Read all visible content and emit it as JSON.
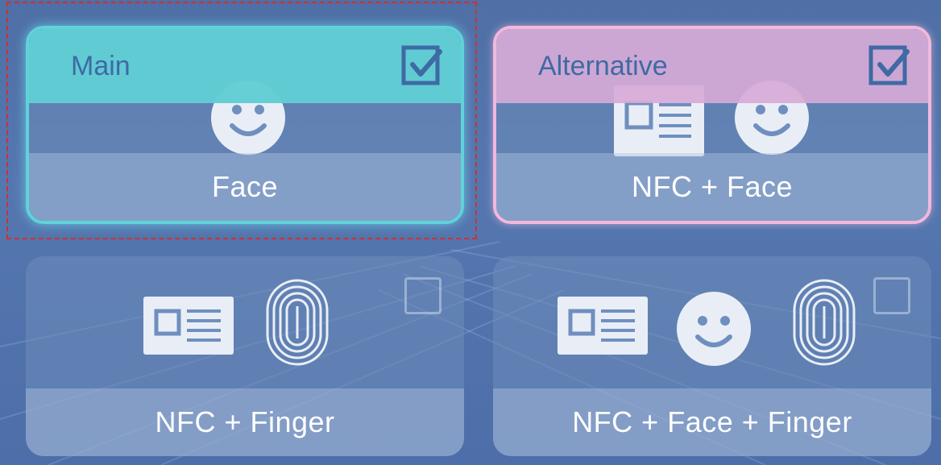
{
  "tiles": [
    {
      "label": "Face",
      "role": "Main",
      "checked": true,
      "icons": [
        "face-icon"
      ]
    },
    {
      "label": "NFC + Face",
      "role": "Alternative",
      "checked": true,
      "icons": [
        "nfc-card-icon",
        "face-icon"
      ]
    },
    {
      "label": "NFC + Finger",
      "role": "",
      "checked": false,
      "icons": [
        "nfc-card-icon",
        "fingerprint-icon"
      ]
    },
    {
      "label": "NFC + Face + Finger",
      "role": "",
      "checked": false,
      "icons": [
        "nfc-card-icon",
        "face-icon",
        "fingerprint-icon"
      ]
    }
  ],
  "colors": {
    "main_accent": "#5fd2da",
    "alternative_accent": "#f2b8db",
    "role_text": "#3f6aa4",
    "focus_outline": "#d32f2f"
  }
}
